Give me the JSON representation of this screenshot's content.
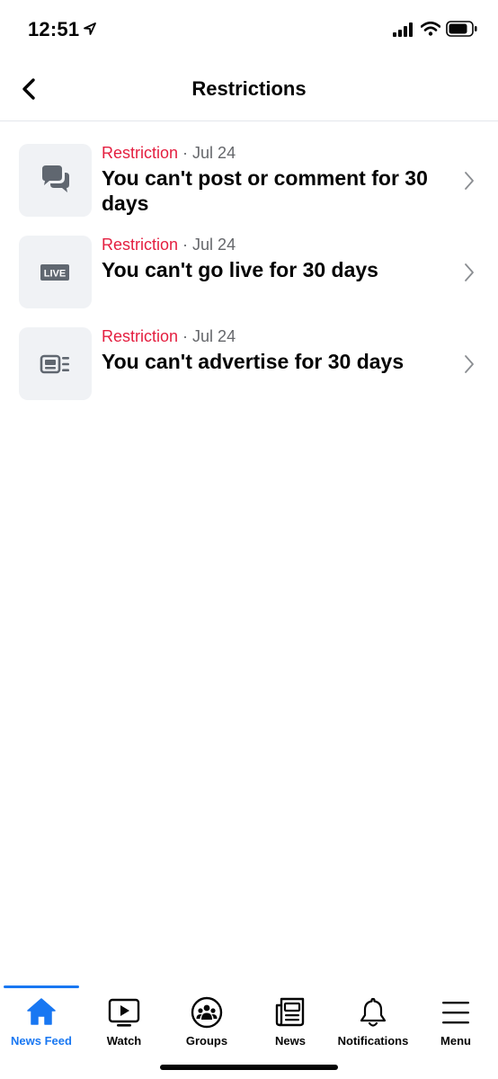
{
  "status_bar": {
    "time": "12:51"
  },
  "header": {
    "title": "Restrictions"
  },
  "restrictions": [
    {
      "type": "Restriction",
      "date": "Jul 24",
      "title": "You can't post or comment for 30 days",
      "icon": "chat-bubbles-icon"
    },
    {
      "type": "Restriction",
      "date": "Jul 24",
      "title": "You can't go live for 30 days",
      "icon": "live-icon",
      "icon_text": "LIVE"
    },
    {
      "type": "Restriction",
      "date": "Jul 24",
      "title": "You can't advertise for 30 days",
      "icon": "ad-icon"
    }
  ],
  "tab_bar": {
    "tabs": [
      {
        "label": "News Feed",
        "icon": "home-icon",
        "active": true
      },
      {
        "label": "Watch",
        "icon": "video-icon",
        "active": false
      },
      {
        "label": "Groups",
        "icon": "groups-icon",
        "active": false
      },
      {
        "label": "News",
        "icon": "newspaper-icon",
        "active": false
      },
      {
        "label": "Notifications",
        "icon": "bell-icon",
        "active": false
      },
      {
        "label": "Menu",
        "icon": "hamburger-menu-icon",
        "active": false
      }
    ]
  },
  "colors": {
    "accent": "#1877f2",
    "restriction": "#e41e3f",
    "secondary_text": "#65676b",
    "icon_bg": "#f0f2f5",
    "icon_fg": "#606770"
  }
}
